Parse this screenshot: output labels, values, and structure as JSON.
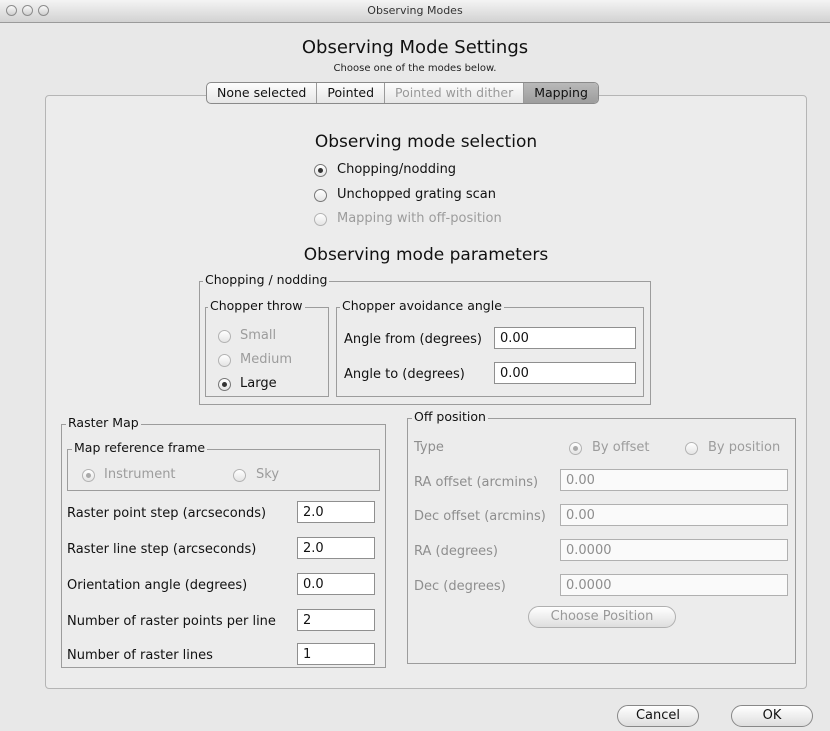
{
  "window": {
    "title": "Observing Modes"
  },
  "header": {
    "title": "Observing Mode Settings",
    "subtitle": "Choose one of the modes below."
  },
  "tabs": [
    {
      "label": "None selected",
      "state": "normal"
    },
    {
      "label": "Pointed",
      "state": "normal"
    },
    {
      "label": "Pointed with dither",
      "state": "disabled"
    },
    {
      "label": "Mapping",
      "state": "selected"
    }
  ],
  "mode_selection": {
    "title": "Observing mode selection",
    "options": [
      {
        "label": "Chopping/nodding",
        "selected": true,
        "enabled": true
      },
      {
        "label": "Unchopped grating scan",
        "selected": false,
        "enabled": true
      },
      {
        "label": "Mapping with off-position",
        "selected": false,
        "enabled": false
      }
    ]
  },
  "parameters": {
    "title": "Observing mode parameters"
  },
  "chopping": {
    "title": "Chopping / nodding",
    "throw": {
      "title": "Chopper throw",
      "options": [
        {
          "label": "Small",
          "selected": false,
          "enabled": false
        },
        {
          "label": "Medium",
          "selected": false,
          "enabled": false
        },
        {
          "label": "Large",
          "selected": true,
          "enabled": true
        }
      ]
    },
    "avoidance": {
      "title": "Chopper avoidance angle",
      "angle_from_label": "Angle from (degrees)",
      "angle_from_value": "0.00",
      "angle_to_label": "Angle to (degrees)",
      "angle_to_value": "0.00"
    }
  },
  "raster": {
    "title": "Raster Map",
    "frame": {
      "title": "Map reference frame",
      "instrument": "Instrument",
      "sky": "Sky",
      "selected": "Instrument"
    },
    "fields": [
      {
        "label": "Raster point step (arcseconds)",
        "value": "2.0"
      },
      {
        "label": "Raster line step (arcseconds)",
        "value": "2.0"
      },
      {
        "label": "Orientation angle (degrees)",
        "value": "0.0"
      },
      {
        "label": "Number of raster points per line",
        "value": "2"
      },
      {
        "label": "Number of raster lines",
        "value": "1"
      }
    ]
  },
  "off_position": {
    "title": "Off position",
    "type_label": "Type",
    "by_offset": "By offset",
    "by_position": "By position",
    "fields": [
      {
        "label": "RA offset (arcmins)",
        "value": "0.00"
      },
      {
        "label": "Dec offset (arcmins)",
        "value": "0.00"
      },
      {
        "label": "RA (degrees)",
        "value": "0.0000"
      },
      {
        "label": "Dec (degrees)",
        "value": "0.0000"
      }
    ],
    "choose_button": "Choose Position"
  },
  "footer": {
    "cancel": "Cancel",
    "ok": "OK"
  }
}
